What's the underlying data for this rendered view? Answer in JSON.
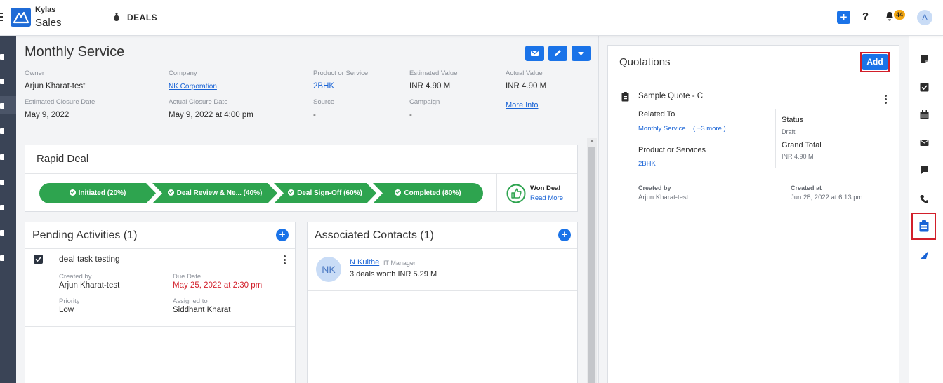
{
  "topbar": {
    "brand_small": "Kylas",
    "brand_main": "Sales",
    "module": "DEALS",
    "notification_count": "44",
    "help": "?",
    "avatar_initial": "A"
  },
  "deal": {
    "title": "Monthly Service",
    "fields": {
      "owner_label": "Owner",
      "owner": "Arjun Kharat-test",
      "company_label": "Company",
      "company": "NK Corporation",
      "product_label": "Product or Service",
      "product": "2BHK",
      "est_value_label": "Estimated Value",
      "est_value": "INR 4.90 M",
      "actual_value_label": "Actual Value",
      "actual_value": "INR 4.90 M",
      "est_close_label": "Estimated Closure Date",
      "est_close": "May 9, 2022",
      "actual_close_label": "Actual Closure Date",
      "actual_close": "May 9, 2022 at 4:00 pm",
      "source_label": "Source",
      "source": "-",
      "campaign_label": "Campaign",
      "campaign": "-",
      "more_info": "More Info"
    }
  },
  "pipeline": {
    "title": "Rapid Deal",
    "stages": [
      {
        "label": "Initiated (20%)"
      },
      {
        "label": "Deal Review & Ne... (40%)"
      },
      {
        "label": "Deal Sign-Off (60%)"
      },
      {
        "label": "Completed (80%)"
      }
    ],
    "won_label": "Won Deal",
    "read_more": "Read More"
  },
  "activities": {
    "title": "Pending Activities (1)",
    "task": {
      "name": "deal task testing",
      "created_by_label": "Created by",
      "created_by": "Arjun Kharat-test",
      "due_label": "Due Date",
      "due": "May 25, 2022 at 2:30 pm",
      "priority_label": "Priority",
      "priority": "Low",
      "assigned_label": "Assigned to",
      "assigned": "Siddhant Kharat"
    }
  },
  "contacts": {
    "title": "Associated Contacts (1)",
    "contact": {
      "initials": "NK",
      "name": "N Kulthe",
      "role": "IT Manager",
      "summary": "3 deals worth INR 5.29 M"
    }
  },
  "quotations": {
    "title": "Quotations",
    "add_label": "Add",
    "quote": {
      "name": "Sample Quote - C",
      "related_label": "Related To",
      "related": "Monthly Service",
      "related_more": "( +3 more )",
      "products_label": "Product or Services",
      "products": "2BHK",
      "status_label": "Status",
      "status": "Draft",
      "total_label": "Grand Total",
      "total": "INR 4.90 M",
      "created_by_label": "Created by",
      "created_by": "Arjun Kharat-test",
      "created_at_label": "Created at",
      "created_at": "Jun 28, 2022 at 6:13 pm"
    }
  },
  "colors": {
    "primary": "#1a73e8",
    "success": "#2ea44f",
    "danger": "#d21f2a",
    "badge": "#f3a712",
    "nav": "#3a4456"
  }
}
